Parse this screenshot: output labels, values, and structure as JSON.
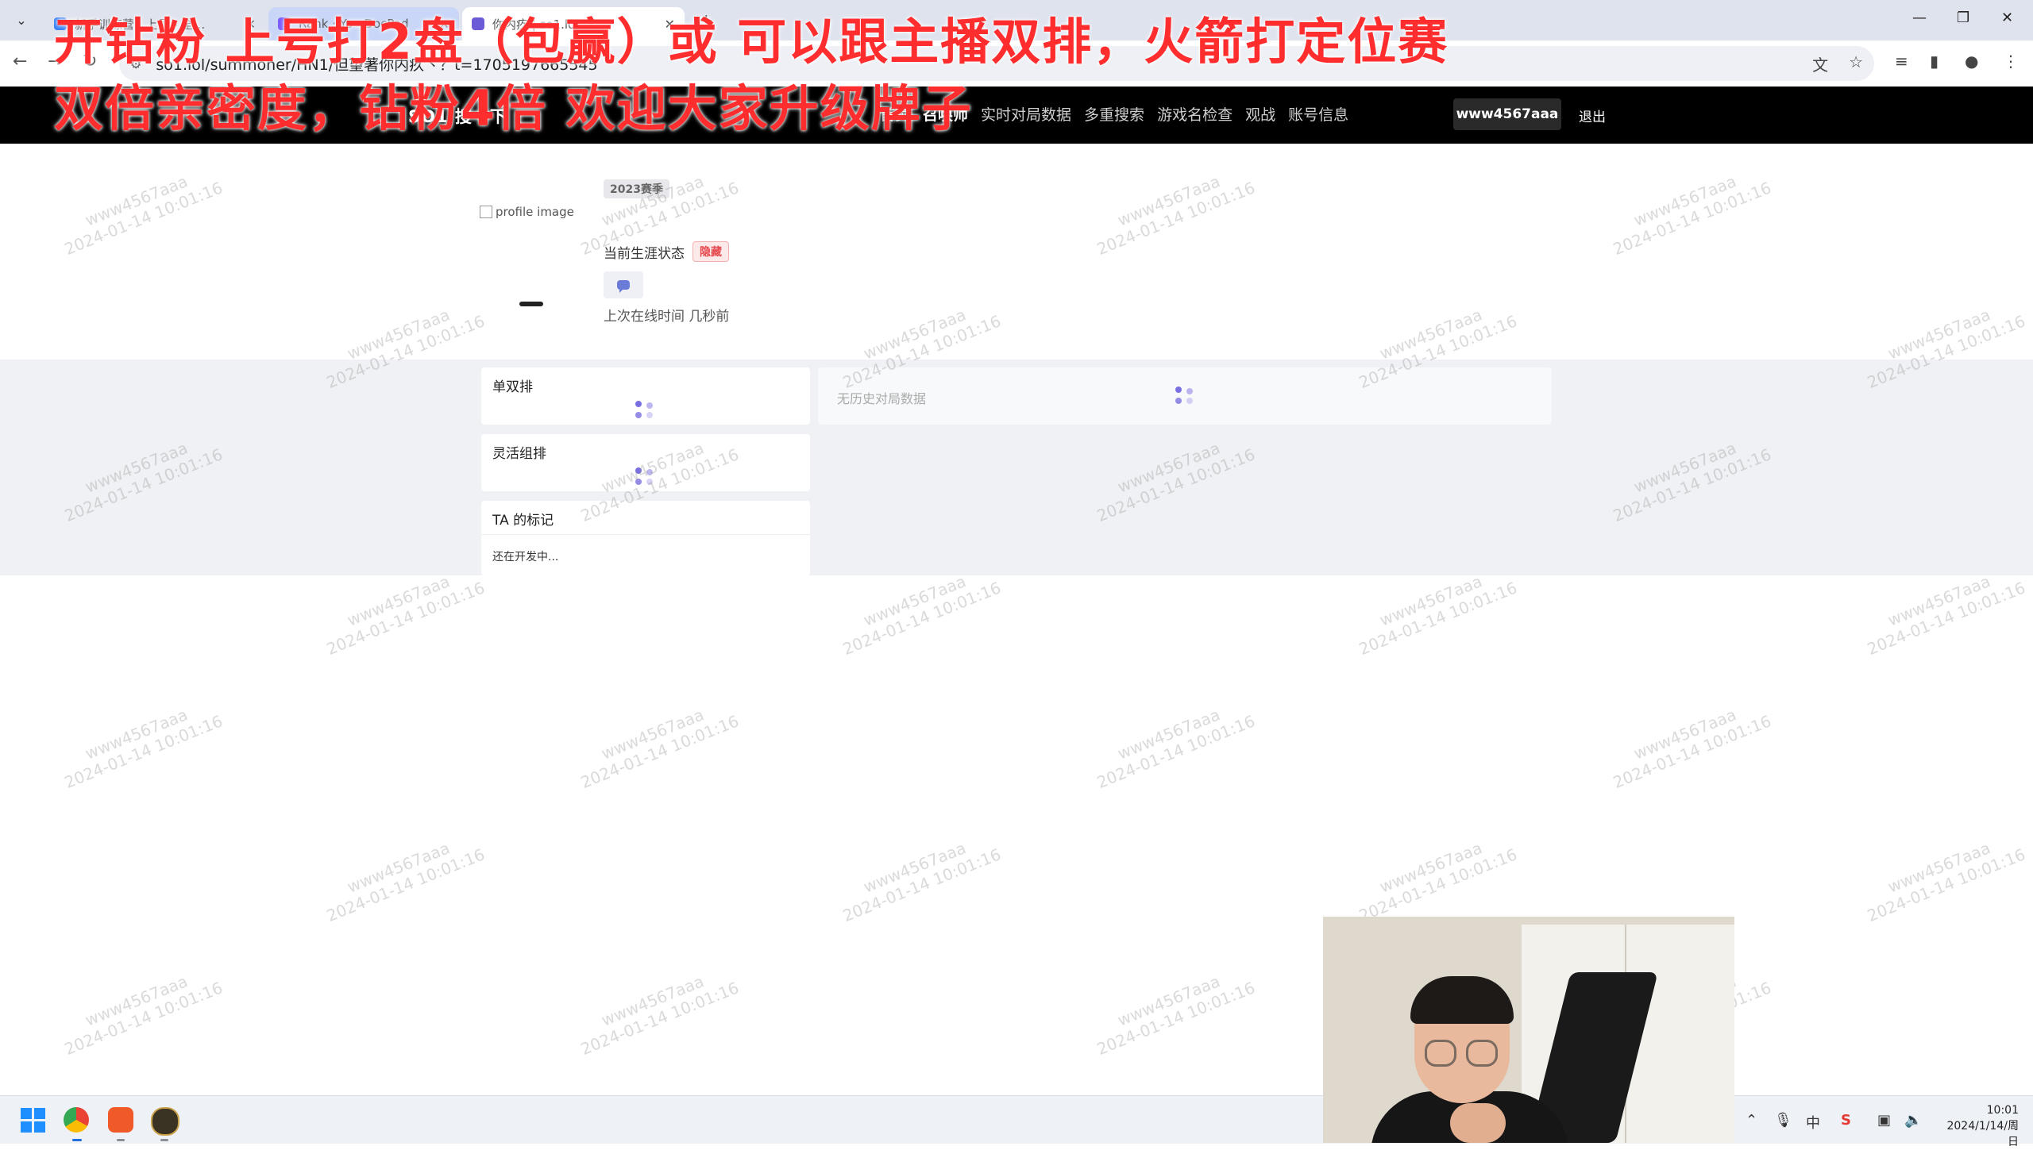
{
  "browser": {
    "tabs": [
      {
        "label": "新手训练营 · 上号 - 全…",
        "active": false
      },
      {
        "label": "Rank · Yo · DocPad",
        "active": false
      },
      {
        "label": "你内疚 | so1.lol - …",
        "active": true
      }
    ],
    "tab_close_glyph": "✕",
    "new_tab_glyph": "+",
    "window_controls": {
      "minimize": "—",
      "restore": "❐",
      "close": "✕"
    },
    "url": "so1.lol/summoner/HN1/但望著你内疚丶？t=1705197665545"
  },
  "site": {
    "brand": "SO1 搜一下",
    "nav": [
      {
        "label": "首页",
        "active": false
      },
      {
        "label": "召唤师",
        "active": true
      },
      {
        "label": "实时对局数据",
        "active": false
      },
      {
        "label": "多重搜索",
        "active": false
      },
      {
        "label": "游戏名检查",
        "active": false
      },
      {
        "label": "观战",
        "active": false
      },
      {
        "label": "账号信息",
        "active": false
      }
    ],
    "username": "www4567aaa",
    "logout": "退出"
  },
  "profile": {
    "image_alt": "profile image",
    "season": "2023赛季",
    "career_label": "当前生涯状态",
    "career_badge": "隐藏",
    "last_online": "上次在线时间 几秒前"
  },
  "cards": {
    "solo_duo": "单双排",
    "flex": "灵活组排",
    "tags_title": "TA 的标记",
    "tags_body": "还在开发中..."
  },
  "history": {
    "empty": "无历史对局数据"
  },
  "watermark": {
    "user": "www4567aaa",
    "time": "2024-01-14 10:01:16"
  },
  "overlay": {
    "line1": "开钻粉 上号打2盘（包赢）或 可以跟主播双排，火箭打定位赛",
    "line2": "双倍亲密度，钻粉4倍 欢迎大家升级牌子"
  },
  "taskbar": {
    "time": "10:01",
    "date": "2024/1/14/周日"
  },
  "colors": {
    "header_bg": "#000000",
    "badge_red": "#e5484d",
    "overlay_red": "#ff2d2d",
    "spinner": "#7a6fe0"
  }
}
